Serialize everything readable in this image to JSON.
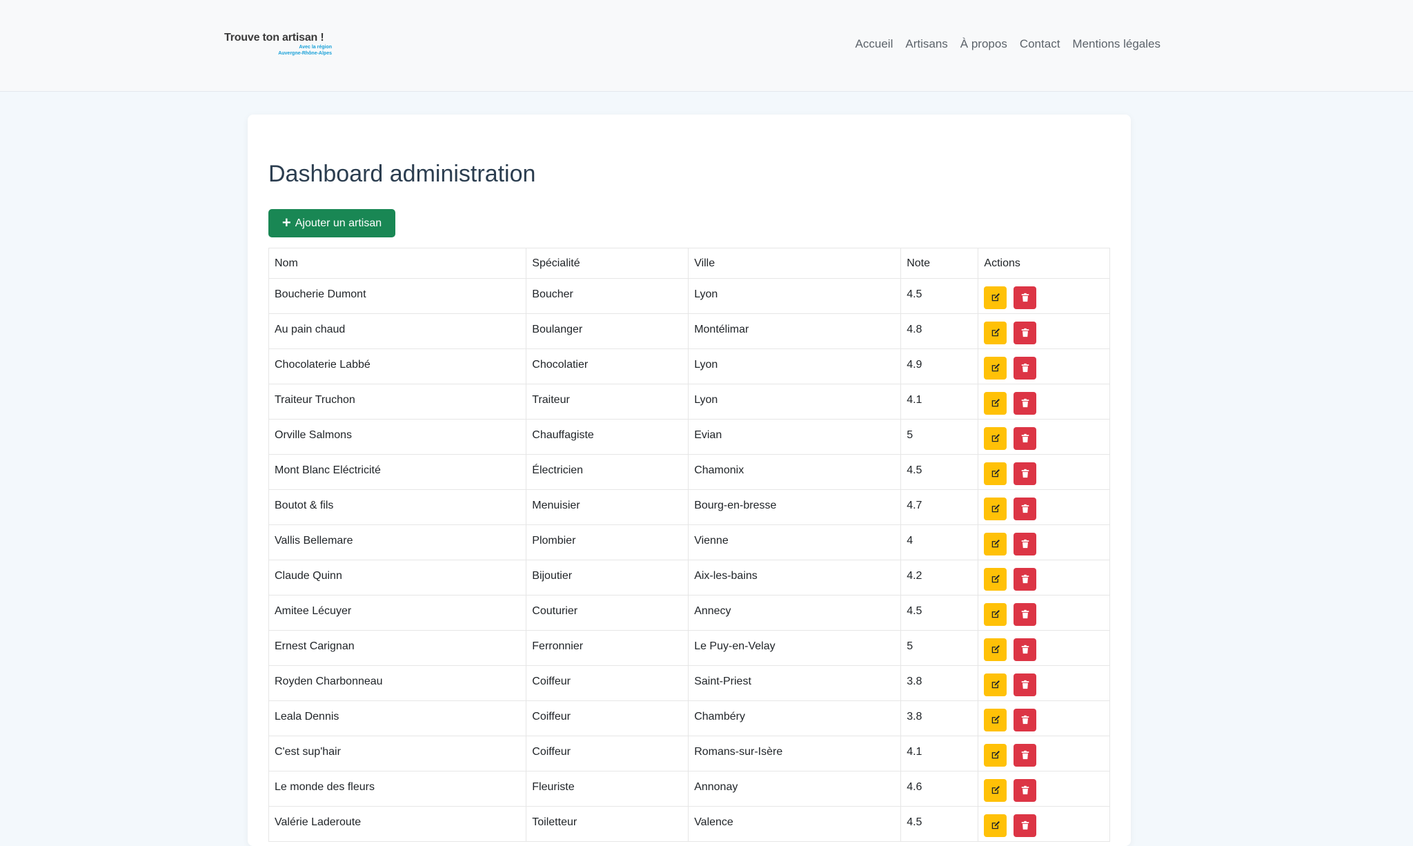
{
  "brand": {
    "title": "Trouve ton artisan !",
    "subtitle_line1": "Avec la région",
    "subtitle_line2": "Auvergne-Rhône-Alpes"
  },
  "nav": [
    "Accueil",
    "Artisans",
    "À propos",
    "Contact",
    "Mentions légales"
  ],
  "page": {
    "title": "Dashboard administration",
    "add_button": "Ajouter un artisan"
  },
  "table": {
    "headers": [
      "Nom",
      "Spécialité",
      "Ville",
      "Note",
      "Actions"
    ],
    "rows": [
      [
        "Boucherie Dumont",
        "Boucher",
        "Lyon",
        "4.5"
      ],
      [
        "Au pain chaud",
        "Boulanger",
        "Montélimar",
        "4.8"
      ],
      [
        "Chocolaterie Labbé",
        "Chocolatier",
        "Lyon",
        "4.9"
      ],
      [
        "Traiteur Truchon",
        "Traiteur",
        "Lyon",
        "4.1"
      ],
      [
        "Orville Salmons",
        "Chauffagiste",
        "Evian",
        "5"
      ],
      [
        "Mont Blanc Eléctricité",
        "Électricien",
        "Chamonix",
        "4.5"
      ],
      [
        "Boutot & fils",
        "Menuisier",
        "Bourg-en-bresse",
        "4.7"
      ],
      [
        "Vallis Bellemare",
        "Plombier",
        "Vienne",
        "4"
      ],
      [
        "Claude Quinn",
        "Bijoutier",
        "Aix-les-bains",
        "4.2"
      ],
      [
        "Amitee Lécuyer",
        "Couturier",
        "Annecy",
        "4.5"
      ],
      [
        "Ernest Carignan",
        "Ferronnier",
        "Le Puy-en-Velay",
        "5"
      ],
      [
        "Royden Charbonneau",
        "Coiffeur",
        "Saint-Priest",
        "3.8"
      ],
      [
        "Leala Dennis",
        "Coiffeur",
        "Chambéry",
        "3.8"
      ],
      [
        "C'est sup'hair",
        "Coiffeur",
        "Romans-sur-Isère",
        "4.1"
      ],
      [
        "Le monde des fleurs",
        "Fleuriste",
        "Annonay",
        "4.6"
      ],
      [
        "Valérie Laderoute",
        "Toiletteur",
        "Valence",
        "4.5"
      ]
    ]
  },
  "icons": {
    "edit": "edit-icon",
    "delete": "trash-icon",
    "add": "plus-icon"
  },
  "colors": {
    "add_button": "#198754",
    "edit_button": "#ffc107",
    "delete_button": "#dc3545"
  }
}
